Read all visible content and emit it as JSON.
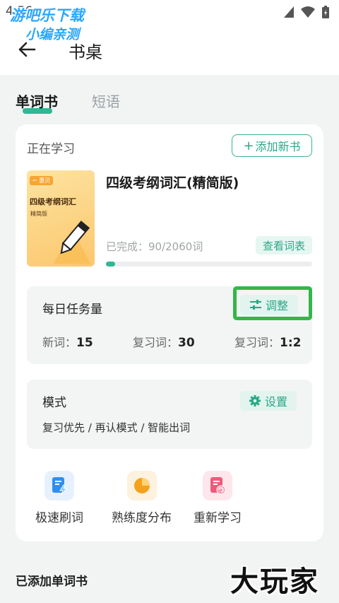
{
  "status_bar": {
    "time": "4:56"
  },
  "watermark_top": {
    "line1": "游吧乐下载",
    "line2": "小编亲测"
  },
  "header": {
    "title": "书桌"
  },
  "tabs": [
    {
      "label": "单词书",
      "active": true
    },
    {
      "label": "短语",
      "active": false
    }
  ],
  "current": {
    "label": "正在学习",
    "add_book": "添加新书",
    "book": {
      "cover_tag": "⌐ 惠贝",
      "cover_title": "四级考纲词汇",
      "cover_subtitle": "精简版",
      "title": "四级考纲词汇(精简版)",
      "progress_text": "已完成：90/2060词",
      "completed": 90,
      "total": 2060,
      "view_list": "查看词表"
    }
  },
  "daily_task": {
    "title": "每日任务量",
    "adjust": "调整",
    "new_words_label": "新词：",
    "new_words": "15",
    "review_words_label": "复习词：",
    "review_words": "30",
    "ratio_label": "复习词：",
    "ratio": "1:2"
  },
  "mode": {
    "title": "模式",
    "settings": "设置",
    "description": "复习优先 / 再认模式 / 智能出词"
  },
  "actions": [
    {
      "label": "极速刷词",
      "icon": "flash-doc-icon",
      "color": "#2f8ff0"
    },
    {
      "label": "熟练度分布",
      "icon": "pie-chart-icon",
      "color": "#f5a11c"
    },
    {
      "label": "重新学习",
      "icon": "refresh-doc-icon",
      "color": "#ef5a7a"
    }
  ],
  "added_books": {
    "title": "已添加单词书"
  },
  "watermark_br": "大玩家",
  "colors": {
    "accent": "#2fb895",
    "highlight": "#35b54a"
  }
}
